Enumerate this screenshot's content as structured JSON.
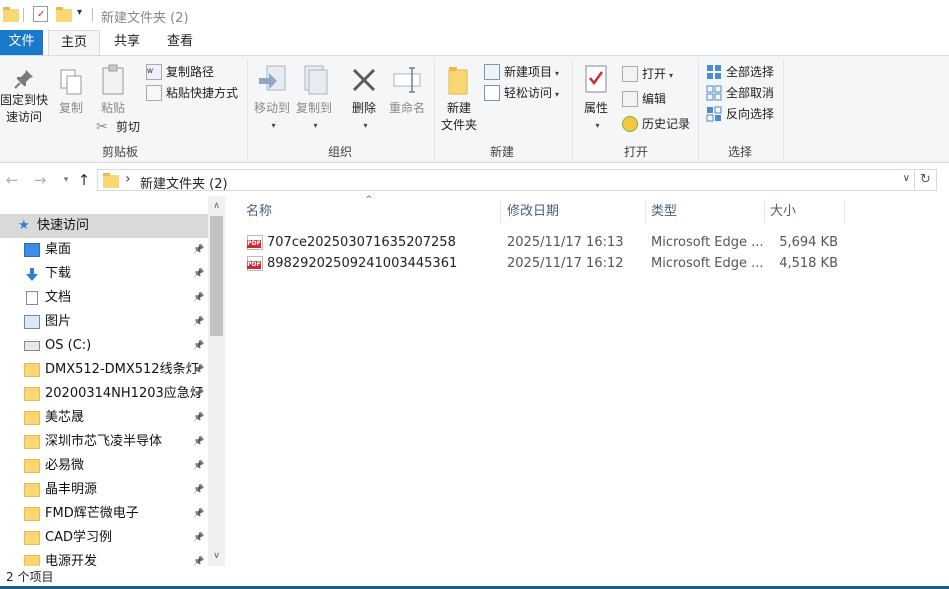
{
  "window": {
    "title": "新建文件夹 (2)"
  },
  "tabs": {
    "file": "文件",
    "home": "主页",
    "share": "共享",
    "view": "查看"
  },
  "ribbon": {
    "clipboard": {
      "label": "剪贴板",
      "pin_quick_access": "固定到快\n速访问",
      "pin_line1": "固定到快",
      "pin_line2": "速访问",
      "copy": "复制",
      "paste": "粘贴",
      "copy_path": "复制路径",
      "paste_shortcut": "粘贴快捷方式",
      "cut": "剪切"
    },
    "organize": {
      "label": "组织",
      "move_to": "移动到",
      "copy_to": "复制到",
      "delete": "删除",
      "rename": "重命名"
    },
    "new": {
      "label": "新建",
      "new_folder_line1": "新建",
      "new_folder_line2": "文件夹",
      "new_item": "新建项目",
      "easy_access": "轻松访问"
    },
    "open": {
      "label": "打开",
      "properties": "属性",
      "open": "打开",
      "edit": "编辑",
      "history": "历史记录"
    },
    "select": {
      "label": "选择",
      "select_all": "全部选择",
      "select_none": "全部取消",
      "invert": "反向选择"
    }
  },
  "address": {
    "crumb_sep": "›",
    "path": "新建文件夹 (2)"
  },
  "nav": {
    "quick_access": "快速访问",
    "items": [
      {
        "label": "桌面",
        "icon": "desktop-icon"
      },
      {
        "label": "下载",
        "icon": "download-icon"
      },
      {
        "label": "文档",
        "icon": "documents-icon"
      },
      {
        "label": "图片",
        "icon": "pictures-icon"
      },
      {
        "label": "OS (C:)",
        "icon": "drive-icon"
      },
      {
        "label": "DMX512-DMX512线条灯",
        "icon": "folder-icon"
      },
      {
        "label": "20200314NH1203应急灯",
        "icon": "folder-icon"
      },
      {
        "label": "美芯晟",
        "icon": "folder-icon"
      },
      {
        "label": "深圳市芯飞凌半导体",
        "icon": "folder-icon"
      },
      {
        "label": "必易微",
        "icon": "folder-icon"
      },
      {
        "label": "晶丰明源",
        "icon": "folder-icon"
      },
      {
        "label": "FMD辉芒微电子",
        "icon": "folder-icon"
      },
      {
        "label": "CAD学习例",
        "icon": "folder-icon"
      },
      {
        "label": "电源开发",
        "icon": "folder-icon"
      }
    ]
  },
  "columns": {
    "name": "名称",
    "modified": "修改日期",
    "type": "类型",
    "size": "大小"
  },
  "files": [
    {
      "name": "707ce202503071635207258",
      "modified": "2025/11/17 16:13",
      "type": "Microsoft Edge ...",
      "size": "5,694 KB"
    },
    {
      "name": "898292025092410034453​61",
      "modified": "2025/11/17 16:12",
      "type": "Microsoft Edge ...",
      "size": "4,518 KB"
    }
  ],
  "status": {
    "count": "2 个项目"
  },
  "colors": {
    "accent": "#1979ca",
    "folder": "#f8d774",
    "pdf": "#d4272e"
  }
}
